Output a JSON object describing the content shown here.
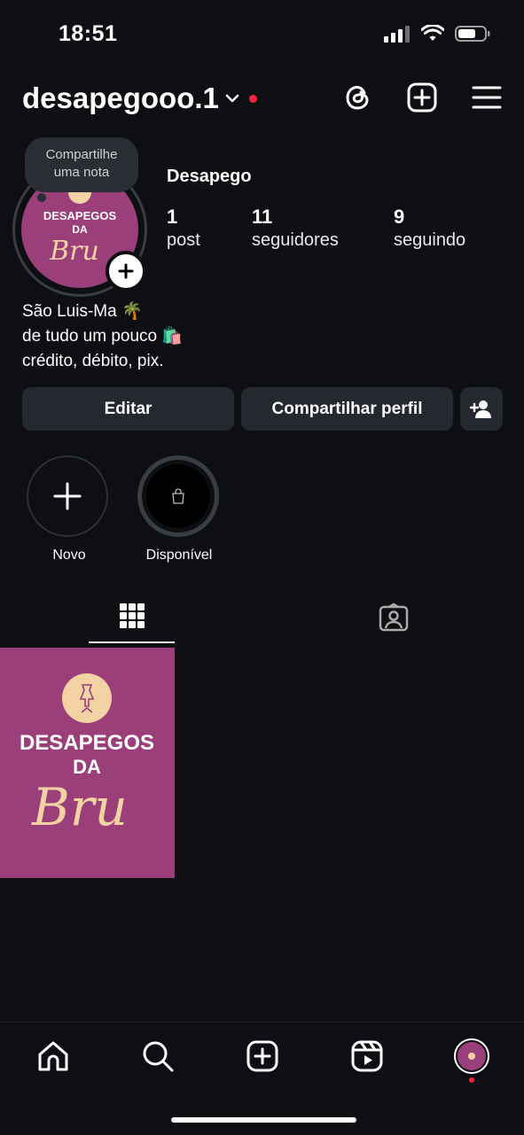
{
  "status_bar": {
    "time": "18:51"
  },
  "header": {
    "username": "desapegooo.1"
  },
  "profile": {
    "note_bubble": {
      "line1": "Compartilhe",
      "line2": "uma nota"
    },
    "avatar_text": {
      "line1": "DESAPEGOS",
      "line2": "DA",
      "script": "Bru"
    },
    "display_name": "Desapego",
    "stats": [
      {
        "value": "1",
        "label": "post"
      },
      {
        "value": "11",
        "label": "seguidores"
      },
      {
        "value": "9",
        "label": "seguindo"
      }
    ],
    "bio": [
      "São Luis-Ma 🌴",
      "de tudo um pouco 🛍️",
      "crédito, débito, pix."
    ]
  },
  "actions": {
    "edit": "Editar",
    "share": "Compartilhar perfil"
  },
  "highlights": [
    {
      "label": "Novo"
    },
    {
      "label": "Disponível"
    }
  ],
  "post": {
    "line1": "DESAPEGOS",
    "line2": "DA",
    "script": "Bru"
  },
  "colors": {
    "background": "#0d0f13",
    "brand": "#9b3f7a",
    "button": "#25282e",
    "notification": "#ff1f3d"
  }
}
